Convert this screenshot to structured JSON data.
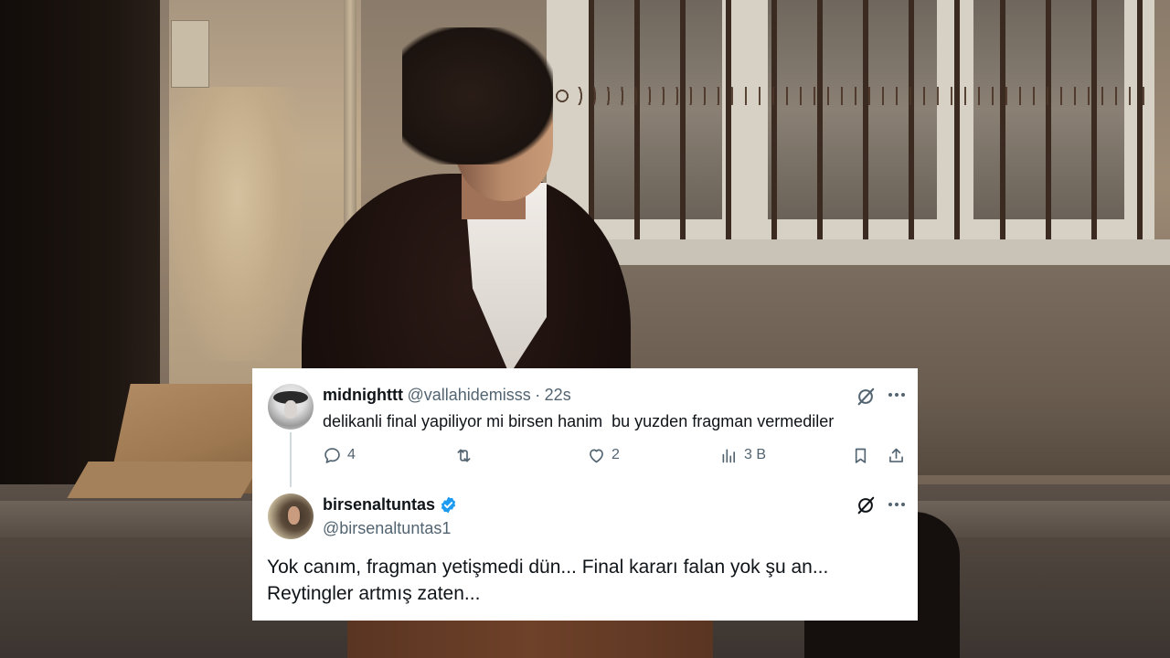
{
  "colors": {
    "card_bg": "#ffffff",
    "text_primary": "#0f1419",
    "text_secondary": "#536471",
    "verified_blue": "#1d9bf0"
  },
  "parent_tweet": {
    "display_name": "midnighttt",
    "handle": "@vallahidemisss",
    "separator": "·",
    "time": "22s",
    "text": "delikanli final yapiliyor mi birsen hanim  bu yuzden fragman vermediler",
    "avatar_icon": "avatar-image",
    "grok_icon": "grok-icon",
    "more_icon": "more-dots-icon",
    "actions": {
      "reply_count": "4",
      "retweet_count": "",
      "like_count": "2",
      "views_count": "3 B"
    }
  },
  "reply_tweet": {
    "display_name": "birsenaltuntas",
    "handle": "@birsenaltuntas1",
    "verified": true,
    "verified_icon": "verified-badge-icon",
    "grok_icon": "grok-icon",
    "more_icon": "more-dots-icon",
    "text_line1": "Yok canım, fragman yetişmedi dün... Final kararı falan yok şu an...",
    "text_line2": "Reytingler artmış zaten..."
  }
}
